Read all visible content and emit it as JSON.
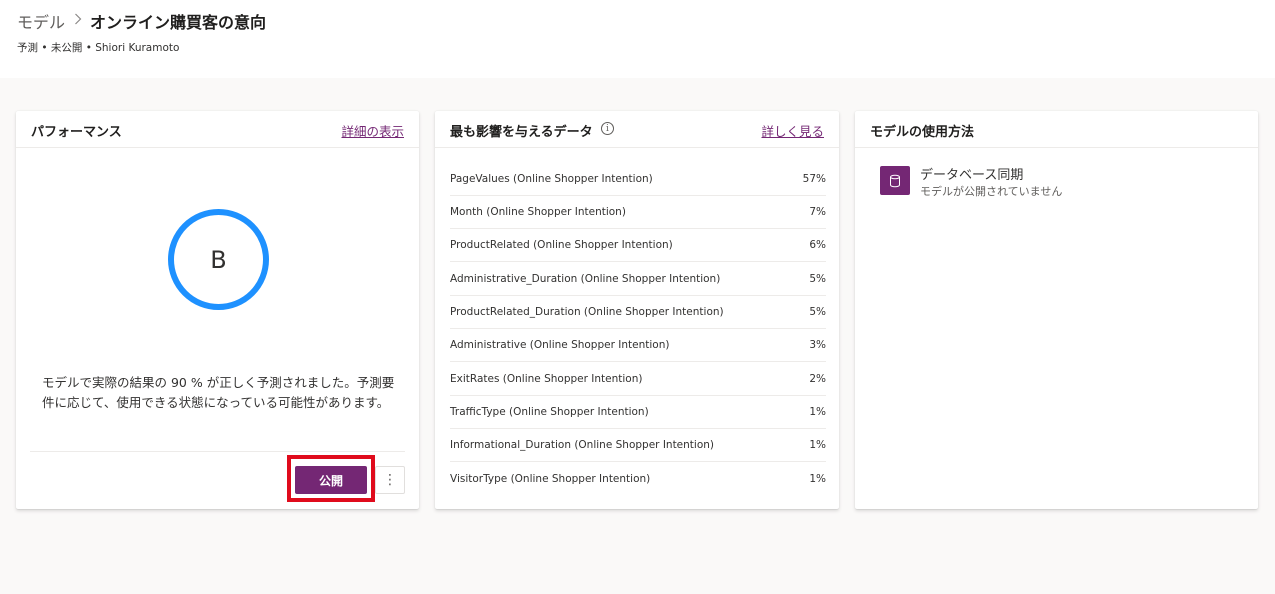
{
  "header": {
    "breadcrumb_parent": "モデル",
    "breadcrumb_current": "オンライン購買客の意向",
    "subtitle": "予測 • 未公開 • Shiori Kuramoto"
  },
  "performance": {
    "title": "パフォーマンス",
    "link": "詳細の表示",
    "grade": "B",
    "description": "モデルで実際の結果の 90 % が正しく予測されました。予測要件に応じて、使用できる状態になっている可能性があります。",
    "publish_label": "公開",
    "more_label": "⋮"
  },
  "influence": {
    "title": "最も影響を与えるデータ",
    "info": "i",
    "link": "詳しく見る",
    "rows": [
      {
        "name": "PageValues (Online Shopper Intention)",
        "pct": "57%"
      },
      {
        "name": "Month (Online Shopper Intention)",
        "pct": "7%"
      },
      {
        "name": "ProductRelated (Online Shopper Intention)",
        "pct": "6%"
      },
      {
        "name": "Administrative_Duration (Online Shopper Intention)",
        "pct": "5%"
      },
      {
        "name": "ProductRelated_Duration (Online Shopper Intention)",
        "pct": "5%"
      },
      {
        "name": "Administrative (Online Shopper Intention)",
        "pct": "3%"
      },
      {
        "name": "ExitRates (Online Shopper Intention)",
        "pct": "2%"
      },
      {
        "name": "TrafficType (Online Shopper Intention)",
        "pct": "1%"
      },
      {
        "name": "Informational_Duration (Online Shopper Intention)",
        "pct": "1%"
      },
      {
        "name": "VisitorType (Online Shopper Intention)",
        "pct": "1%"
      }
    ]
  },
  "usage": {
    "title": "モデルの使用方法",
    "item_title": "データベース同期",
    "item_sub": "モデルが公開されていません",
    "item_icon": "database-icon"
  },
  "colors": {
    "accent": "#742774",
    "grade_ring": "#1e91ff",
    "highlight": "#e00b1c"
  }
}
